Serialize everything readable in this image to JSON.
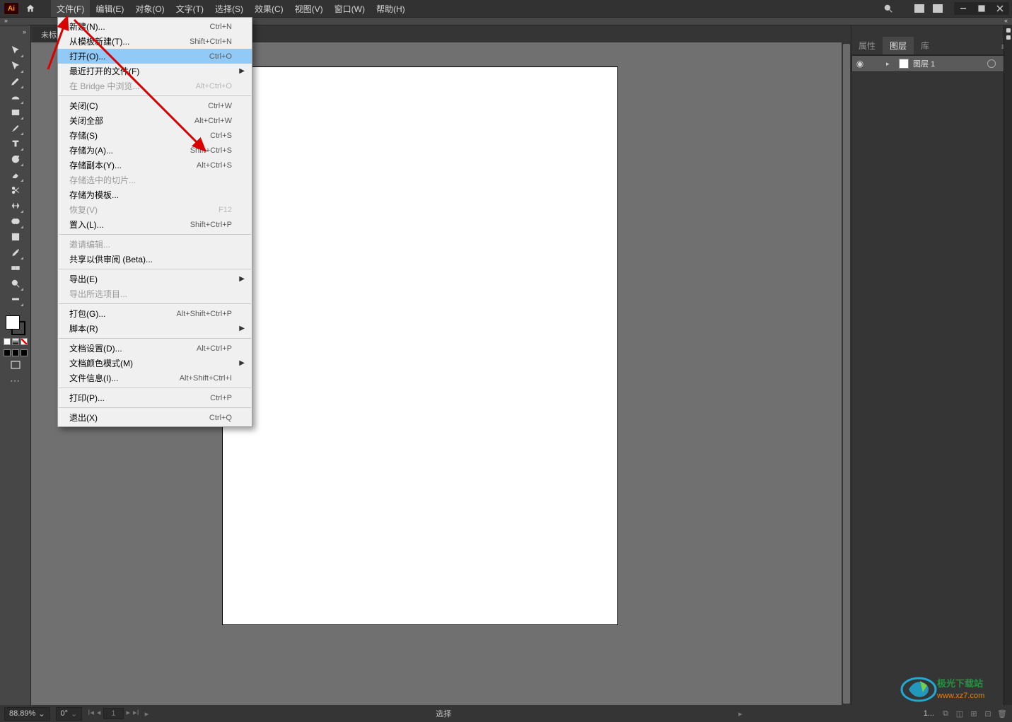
{
  "app": {
    "short": "Ai"
  },
  "menubar": [
    "文件(F)",
    "编辑(E)",
    "对象(O)",
    "文字(T)",
    "选择(S)",
    "效果(C)",
    "视图(V)",
    "窗口(W)",
    "帮助(H)"
  ],
  "doctab": "未标题",
  "file_menu": [
    {
      "type": "item",
      "label": "新建(N)...",
      "shortcut": "Ctrl+N"
    },
    {
      "type": "item",
      "label": "从模板新建(T)...",
      "shortcut": "Shift+Ctrl+N"
    },
    {
      "type": "item",
      "label": "打开(O)...",
      "shortcut": "Ctrl+O",
      "hi": true
    },
    {
      "type": "item",
      "label": "最近打开的文件(F)",
      "submenu": true
    },
    {
      "type": "item",
      "label": "在 Bridge 中浏览...",
      "shortcut": "Alt+Ctrl+O",
      "disabled": true
    },
    {
      "type": "sep"
    },
    {
      "type": "item",
      "label": "关闭(C)",
      "shortcut": "Ctrl+W"
    },
    {
      "type": "item",
      "label": "关闭全部",
      "shortcut": "Alt+Ctrl+W"
    },
    {
      "type": "item",
      "label": "存储(S)",
      "shortcut": "Ctrl+S"
    },
    {
      "type": "item",
      "label": "存储为(A)...",
      "shortcut": "Shift+Ctrl+S"
    },
    {
      "type": "item",
      "label": "存储副本(Y)...",
      "shortcut": "Alt+Ctrl+S"
    },
    {
      "type": "item",
      "label": "存储选中的切片...",
      "disabled": true
    },
    {
      "type": "item",
      "label": "存储为模板..."
    },
    {
      "type": "item",
      "label": "恢复(V)",
      "shortcut": "F12",
      "disabled": true
    },
    {
      "type": "item",
      "label": "置入(L)...",
      "shortcut": "Shift+Ctrl+P"
    },
    {
      "type": "sep"
    },
    {
      "type": "item",
      "label": "邀请编辑...",
      "disabled": true
    },
    {
      "type": "item",
      "label": "共享以供审阅 (Beta)..."
    },
    {
      "type": "sep"
    },
    {
      "type": "item",
      "label": "导出(E)",
      "submenu": true
    },
    {
      "type": "item",
      "label": "导出所选项目...",
      "disabled": true
    },
    {
      "type": "sep"
    },
    {
      "type": "item",
      "label": "打包(G)...",
      "shortcut": "Alt+Shift+Ctrl+P"
    },
    {
      "type": "item",
      "label": "脚本(R)",
      "submenu": true
    },
    {
      "type": "sep"
    },
    {
      "type": "item",
      "label": "文档设置(D)...",
      "shortcut": "Alt+Ctrl+P"
    },
    {
      "type": "item",
      "label": "文档颜色模式(M)",
      "submenu": true
    },
    {
      "type": "item",
      "label": "文件信息(I)...",
      "shortcut": "Alt+Shift+Ctrl+I"
    },
    {
      "type": "sep"
    },
    {
      "type": "item",
      "label": "打印(P)...",
      "shortcut": "Ctrl+P"
    },
    {
      "type": "sep"
    },
    {
      "type": "item",
      "label": "退出(X)",
      "shortcut": "Ctrl+Q"
    }
  ],
  "panels": {
    "tabs": [
      "属性",
      "图层",
      "库"
    ],
    "active": 1,
    "layer_name": "图层 1"
  },
  "status": {
    "zoom": "88.89%",
    "rotate": "0°",
    "page": "1",
    "mode": "选择",
    "count": "1..."
  },
  "tools": [
    "selection",
    "direct-selection",
    "pen",
    "curvature",
    "rectangle",
    "paintbrush",
    "type",
    "rotate",
    "eraser",
    "scissors",
    "width",
    "shape-builder",
    "mesh",
    "eyedropper",
    "blend",
    "column-graph",
    "zoom"
  ],
  "watermark": "极光下载站 www.xz7.com"
}
